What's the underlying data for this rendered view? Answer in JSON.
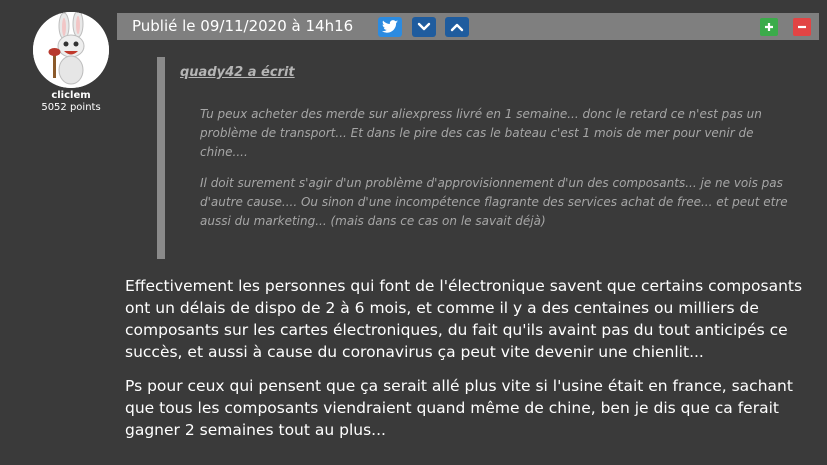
{
  "user": {
    "name": "cliclem",
    "points": "5052 points"
  },
  "post": {
    "date": "Publié le 09/11/2020 à 14h16",
    "icons": {
      "share": "twitter-icon",
      "down": "chevron-down-icon",
      "up": "chevron-up-icon",
      "plus": "plus-icon",
      "minus": "minus-icon"
    },
    "colors": {
      "bar": "#7f7f7f",
      "twitter": "#2c8be0",
      "nav": "#1f5c9e",
      "plus": "#3bab4a",
      "minus": "#e24444"
    }
  },
  "quote": {
    "author": "quady42 a écrit",
    "paragraphs": [
      "Tu peux acheter des merde sur aliexpress livré en 1 semaine... donc le retard ce n'est pas un problème de transport... Et dans le pire des cas le bateau c'est 1 mois de mer pour venir de chine....",
      "Il doit surement s'agir d'un problème d'approvisionnement d'un des composants... je ne vois pas d'autre cause.... Ou sinon d'une incompétence flagrante des services achat de free... et peut etre aussi du marketing... (mais dans ce cas on le savait déjà)"
    ]
  },
  "message": {
    "paragraphs": [
      "Effectivement les personnes qui font de l'électronique savent que certains composants ont un délais de dispo de 2 à 6 mois, et comme il y a des centaines ou milliers de composants sur les cartes électroniques, du fait qu'ils avaint pas du tout anticipés ce succès, et aussi à cause du coronavirus ça peut vite devenir une chienlit...",
      "Ps pour ceux qui pensent que ça serait allé plus vite si l'usine était en france, sachant que tous les composants viendraient quand même de chine, ben je dis que ca ferait gagner 2 semaines tout au plus..."
    ]
  }
}
